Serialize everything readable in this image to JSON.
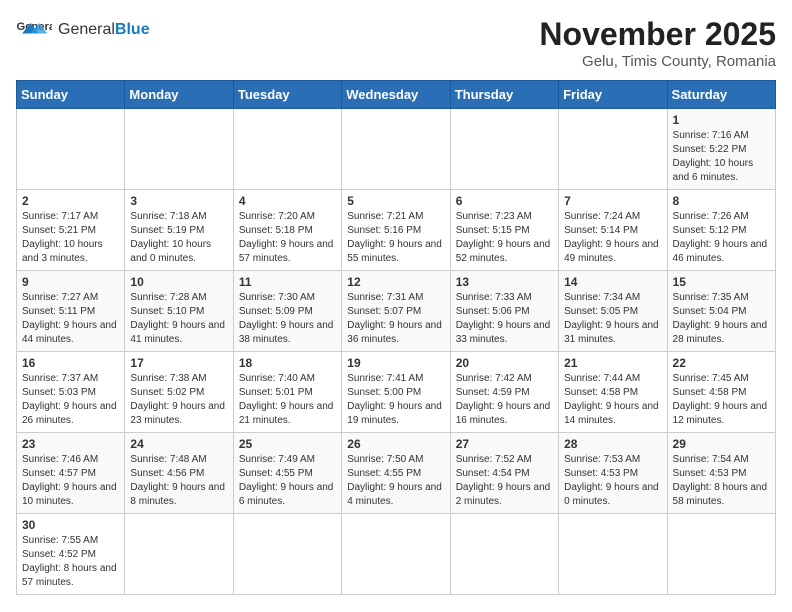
{
  "header": {
    "logo_general": "General",
    "logo_blue": "Blue",
    "month_title": "November 2025",
    "location": "Gelu, Timis County, Romania"
  },
  "weekdays": [
    "Sunday",
    "Monday",
    "Tuesday",
    "Wednesday",
    "Thursday",
    "Friday",
    "Saturday"
  ],
  "weeks": [
    [
      {
        "day": "",
        "content": ""
      },
      {
        "day": "",
        "content": ""
      },
      {
        "day": "",
        "content": ""
      },
      {
        "day": "",
        "content": ""
      },
      {
        "day": "",
        "content": ""
      },
      {
        "day": "",
        "content": ""
      },
      {
        "day": "1",
        "content": "Sunrise: 7:16 AM\nSunset: 5:22 PM\nDaylight: 10 hours and 6 minutes."
      }
    ],
    [
      {
        "day": "2",
        "content": "Sunrise: 7:17 AM\nSunset: 5:21 PM\nDaylight: 10 hours and 3 minutes."
      },
      {
        "day": "3",
        "content": "Sunrise: 7:18 AM\nSunset: 5:19 PM\nDaylight: 10 hours and 0 minutes."
      },
      {
        "day": "4",
        "content": "Sunrise: 7:20 AM\nSunset: 5:18 PM\nDaylight: 9 hours and 57 minutes."
      },
      {
        "day": "5",
        "content": "Sunrise: 7:21 AM\nSunset: 5:16 PM\nDaylight: 9 hours and 55 minutes."
      },
      {
        "day": "6",
        "content": "Sunrise: 7:23 AM\nSunset: 5:15 PM\nDaylight: 9 hours and 52 minutes."
      },
      {
        "day": "7",
        "content": "Sunrise: 7:24 AM\nSunset: 5:14 PM\nDaylight: 9 hours and 49 minutes."
      },
      {
        "day": "8",
        "content": "Sunrise: 7:26 AM\nSunset: 5:12 PM\nDaylight: 9 hours and 46 minutes."
      }
    ],
    [
      {
        "day": "9",
        "content": "Sunrise: 7:27 AM\nSunset: 5:11 PM\nDaylight: 9 hours and 44 minutes."
      },
      {
        "day": "10",
        "content": "Sunrise: 7:28 AM\nSunset: 5:10 PM\nDaylight: 9 hours and 41 minutes."
      },
      {
        "day": "11",
        "content": "Sunrise: 7:30 AM\nSunset: 5:09 PM\nDaylight: 9 hours and 38 minutes."
      },
      {
        "day": "12",
        "content": "Sunrise: 7:31 AM\nSunset: 5:07 PM\nDaylight: 9 hours and 36 minutes."
      },
      {
        "day": "13",
        "content": "Sunrise: 7:33 AM\nSunset: 5:06 PM\nDaylight: 9 hours and 33 minutes."
      },
      {
        "day": "14",
        "content": "Sunrise: 7:34 AM\nSunset: 5:05 PM\nDaylight: 9 hours and 31 minutes."
      },
      {
        "day": "15",
        "content": "Sunrise: 7:35 AM\nSunset: 5:04 PM\nDaylight: 9 hours and 28 minutes."
      }
    ],
    [
      {
        "day": "16",
        "content": "Sunrise: 7:37 AM\nSunset: 5:03 PM\nDaylight: 9 hours and 26 minutes."
      },
      {
        "day": "17",
        "content": "Sunrise: 7:38 AM\nSunset: 5:02 PM\nDaylight: 9 hours and 23 minutes."
      },
      {
        "day": "18",
        "content": "Sunrise: 7:40 AM\nSunset: 5:01 PM\nDaylight: 9 hours and 21 minutes."
      },
      {
        "day": "19",
        "content": "Sunrise: 7:41 AM\nSunset: 5:00 PM\nDaylight: 9 hours and 19 minutes."
      },
      {
        "day": "20",
        "content": "Sunrise: 7:42 AM\nSunset: 4:59 PM\nDaylight: 9 hours and 16 minutes."
      },
      {
        "day": "21",
        "content": "Sunrise: 7:44 AM\nSunset: 4:58 PM\nDaylight: 9 hours and 14 minutes."
      },
      {
        "day": "22",
        "content": "Sunrise: 7:45 AM\nSunset: 4:58 PM\nDaylight: 9 hours and 12 minutes."
      }
    ],
    [
      {
        "day": "23",
        "content": "Sunrise: 7:46 AM\nSunset: 4:57 PM\nDaylight: 9 hours and 10 minutes."
      },
      {
        "day": "24",
        "content": "Sunrise: 7:48 AM\nSunset: 4:56 PM\nDaylight: 9 hours and 8 minutes."
      },
      {
        "day": "25",
        "content": "Sunrise: 7:49 AM\nSunset: 4:55 PM\nDaylight: 9 hours and 6 minutes."
      },
      {
        "day": "26",
        "content": "Sunrise: 7:50 AM\nSunset: 4:55 PM\nDaylight: 9 hours and 4 minutes."
      },
      {
        "day": "27",
        "content": "Sunrise: 7:52 AM\nSunset: 4:54 PM\nDaylight: 9 hours and 2 minutes."
      },
      {
        "day": "28",
        "content": "Sunrise: 7:53 AM\nSunset: 4:53 PM\nDaylight: 9 hours and 0 minutes."
      },
      {
        "day": "29",
        "content": "Sunrise: 7:54 AM\nSunset: 4:53 PM\nDaylight: 8 hours and 58 minutes."
      }
    ],
    [
      {
        "day": "30",
        "content": "Sunrise: 7:55 AM\nSunset: 4:52 PM\nDaylight: 8 hours and 57 minutes."
      },
      {
        "day": "",
        "content": ""
      },
      {
        "day": "",
        "content": ""
      },
      {
        "day": "",
        "content": ""
      },
      {
        "day": "",
        "content": ""
      },
      {
        "day": "",
        "content": ""
      },
      {
        "day": "",
        "content": ""
      }
    ]
  ]
}
